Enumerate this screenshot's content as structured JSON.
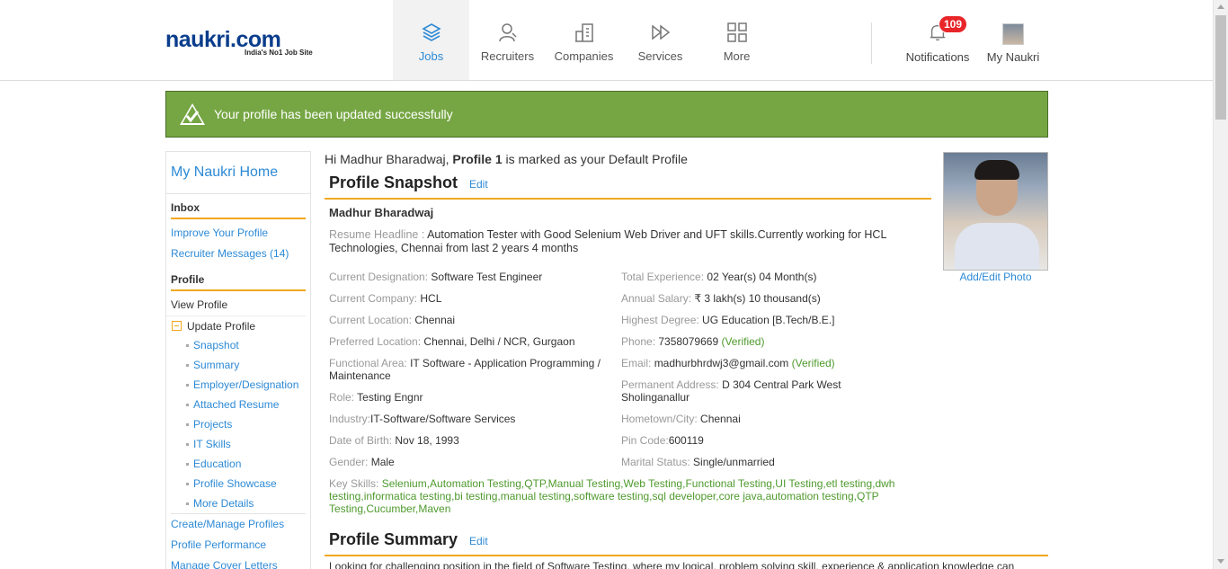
{
  "header": {
    "logo_text": "naukri.com",
    "logo_tagline": "India's No1 Job Site",
    "nav": [
      {
        "label": "Jobs",
        "icon": "layers-icon"
      },
      {
        "label": "Recruiters",
        "icon": "person-icon"
      },
      {
        "label": "Companies",
        "icon": "building-icon"
      },
      {
        "label": "Services",
        "icon": "fast-forward-icon"
      },
      {
        "label": "More",
        "icon": "grid-icon"
      }
    ],
    "notifications_label": "Notifications",
    "notifications_count": "109",
    "my_naukri_label": "My Naukri"
  },
  "alert": {
    "message": "Your profile has been updated successfully",
    "color": "#76a644"
  },
  "sidebar": {
    "home": "My Naukri Home",
    "inbox_heading": "Inbox",
    "inbox_links": [
      "Improve Your Profile",
      "Recruiter Messages (14)"
    ],
    "profile_heading": "Profile",
    "view_profile": "View Profile",
    "update_profile": "Update Profile",
    "update_subitems": [
      "Snapshot",
      "Summary",
      "Employer/Designation",
      "Attached Resume",
      "Projects",
      "IT Skills",
      "Education",
      "Profile Showcase",
      "More Details"
    ],
    "bottom_links": [
      "Create/Manage Profiles",
      "Profile Performance",
      "Manage Cover Letters"
    ]
  },
  "greeting": {
    "prefix": "Hi Madhur Bharadwaj, ",
    "profile_name": "Profile 1",
    "suffix": " is marked as your Default Profile"
  },
  "snapshot": {
    "title": "Profile Snapshot",
    "edit": "Edit",
    "name": "Madhur Bharadwaj",
    "headline_label": "Resume Headline : ",
    "headline_value": "Automation Tester with Good Selenium Web Driver and UFT skills.Currently working for HCL Technologies, Chennai from last 2 years 4 months",
    "left_fields": [
      {
        "label": "Current Designation: ",
        "value": "Software Test Engineer"
      },
      {
        "label": "Current Company: ",
        "value": "HCL"
      },
      {
        "label": "Current Location: ",
        "value": "Chennai"
      },
      {
        "label": "Preferred Location: ",
        "value": "Chennai, Delhi / NCR, Gurgaon"
      },
      {
        "label": "Functional Area: ",
        "value": "IT Software - Application Programming / Maintenance"
      },
      {
        "label": "Role: ",
        "value": "Testing Engnr"
      },
      {
        "label": "Industry:",
        "value": "IT-Software/Software Services"
      },
      {
        "label": "Date of Birth: ",
        "value": "Nov 18, 1993"
      },
      {
        "label": "Gender: ",
        "value": "Male"
      }
    ],
    "right_fields": [
      {
        "label": "Total Experience: ",
        "value": "02 Year(s) 04 Month(s)"
      },
      {
        "label": "Annual Salary: ",
        "value": "₹ 3 lakh(s) 10 thousand(s)"
      },
      {
        "label": "Highest Degree: ",
        "value": "UG Education [B.Tech/B.E.]"
      },
      {
        "label": "Phone: ",
        "value": "7358079669",
        "extra": " (Verified)"
      },
      {
        "label": "Email: ",
        "value": "madhurbhrdwj3@gmail.com",
        "extra": " (Verified)"
      },
      {
        "label": "Permanent Address: ",
        "value": "D 304 Central Park West Sholinganallur"
      },
      {
        "label": "Hometown/City: ",
        "value": "Chennai"
      },
      {
        "label": "Pin Code:",
        "value": "600119"
      },
      {
        "label": "Marital Status: ",
        "value": "Single/unmarried"
      }
    ],
    "key_skills_label": "Key Skills: ",
    "key_skills": "Selenium,Automation Testing,QTP,Manual Testing,Web Testing,Functional Testing,UI Testing,etl testing,dwh testing,informatica testing,bi testing,manual testing,software testing,sql developer,core java,automation testing,QTP Testing,Cucumber,Maven"
  },
  "photo": {
    "link": "Add/Edit Photo"
  },
  "summary": {
    "title": "Profile Summary",
    "edit": "Edit",
    "text": "Looking for challenging position in the field of Software Testing, where my logical, problem solving skill, experience & application knowledge can"
  }
}
